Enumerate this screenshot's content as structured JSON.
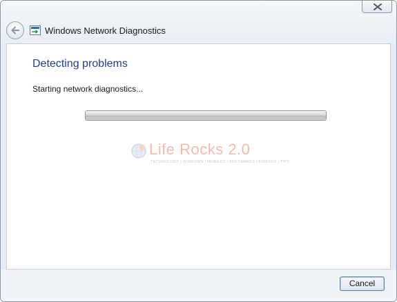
{
  "window": {
    "title": "Windows Network Diagnostics"
  },
  "content": {
    "heading": "Detecting problems",
    "status": "Starting network diagnostics...",
    "progress_fraction": 1.0
  },
  "watermark": {
    "title": "Life Rocks 2.0",
    "tagline": "TECHNOLOGY | WINDOWS | MOBILES | SOFTWARES | FIREFOX | TIPS"
  },
  "footer": {
    "cancel_label": "Cancel"
  },
  "colors": {
    "heading": "#1e3f8f",
    "watermark": "#f2b9ad",
    "button_border": "#5a7fa8"
  },
  "icons": {
    "close": "close-icon",
    "back": "back-arrow-icon",
    "app": "network-diagnostics-icon",
    "watermark_logo": "globe-icon"
  }
}
